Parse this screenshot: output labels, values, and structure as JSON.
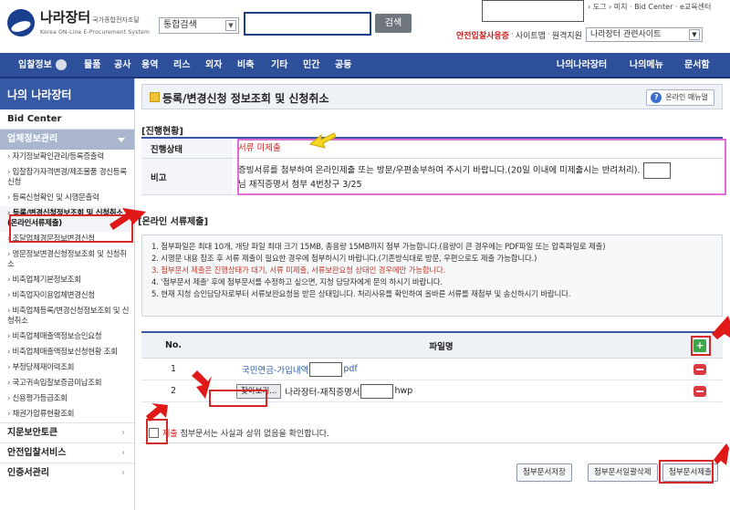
{
  "header": {
    "logo_name": "나라장터",
    "logo_small": "국가종합전자조달",
    "logo_sub": "Korea ON-Line E-Procurement System",
    "search_select": "통합검색",
    "search_button": "검색",
    "top_links": "› 도그 › 미치 · Bid Center · e교육센터",
    "util_red": "안전입찰사용증",
    "util_sitemap": "사이트맵",
    "util_remote": "원격지원",
    "site_select": "나라장터 관련사이트"
  },
  "nav": {
    "items": [
      "입찰정보",
      "물품",
      "공사",
      "용역",
      "리스",
      "외자",
      "비축",
      "기타",
      "민간",
      "공동",
      "나의나라장터",
      "나의메뉴",
      "문서함"
    ]
  },
  "sidebar": {
    "title": "나의 나라장터",
    "bid_center": "Bid Center",
    "section": "업체정보관리",
    "links": [
      "자기정보확인관리/등록증출력",
      "입찰참가자격변경/제조물품 경신등록신청",
      "등록신청확인 및 시행문출력",
      "등록/변경신청정보조회 및 신청취소(온라인서류제출)",
      "조달업체경문정보변경신청",
      "영문정보변경신청정보조회 및 신청취소",
      "비축업체기본정보조회",
      "비축업자이용업체변경신청",
      "비축업체등록/변경신청정보조회 및 신청취소",
      "비축업체매출액정보승인요청",
      "비축업체매출액정보신청현황 조회",
      "부정당제재이력조회",
      "국고귀속입찰보증금미납조회",
      "신용평가등급조회",
      "채권가압류현황조회"
    ],
    "bottom": [
      "지문보안토큰",
      "안전입찰서비스",
      "인증서관리"
    ]
  },
  "main": {
    "title": "등록/변경신청 정보조회 및 신청취소",
    "help_button": "온라인 매뉴얼",
    "progress_label": "[진행현황]",
    "status_label": "진행상태",
    "status_value": "서류 미제출",
    "remark_label": "비고",
    "remark_text_1": "증빙서류를 첨부하여 온라인제출 또는 방문/우편송부하여 주시기 바랍니다.(20일 이내에 미제출시는 반려처리).",
    "remark_text_2": "님 재직증명서 첨부 4번창구 3/25",
    "online_label": "[온라인 서류제출]",
    "notices": [
      "1. 첨부파일은 최대 10개, 개당 파일 최대 크기 15MB, 총용량 15MB까지 첨부 가능합니다.(용량이 큰 경우에는 PDF파일 또는 압축파일로 제출)",
      "2. 시행문 내용 참조 후 서류 제출이 필요한 경우에 첨부하시기 바랍니다.(기존방식대로 방문, 우편으로도 제출 가능합니다.)",
      "3. 첨부문서 제출은 진행상태가 대기, 서류 미제출, 서류보완요청 상태인 경우에만 가능합니다.",
      "4. '첨부문서 제출' 후에 첨부문서를 수정하고 싶으면, 지청 담당자에게 문의 하시기 바랍니다.",
      "5. 현재 지청 승인담당자로부터 서류보완요청을 받은 상태입니다. 처리사유를 확인하여 올바른 서류를 재첨부 및 송신하시기 바랍니다."
    ],
    "file_col_no": "No.",
    "file_col_name": "파일명",
    "files": [
      {
        "no": "1",
        "name_a": "국민연금-가입내역",
        "name_b": "pdf"
      },
      {
        "no": "2",
        "browse": "찾아보기...",
        "name_a": "나라장터-재직증명서",
        "name_b": "hwp"
      }
    ],
    "confirm_red": "제출",
    "confirm_text": "첨부문서는 사실과 상위 없음을 확인합니다.",
    "btn_save": "첨부문서저장",
    "btn_delete": "첨부문서일괄삭제",
    "btn_submit": "첨부문서제출"
  },
  "colors": {
    "nav_blue": "#2e4f9a",
    "side_head": "#3559a4",
    "highlight_red": "#d62828",
    "status_red": "#d21f1f"
  }
}
